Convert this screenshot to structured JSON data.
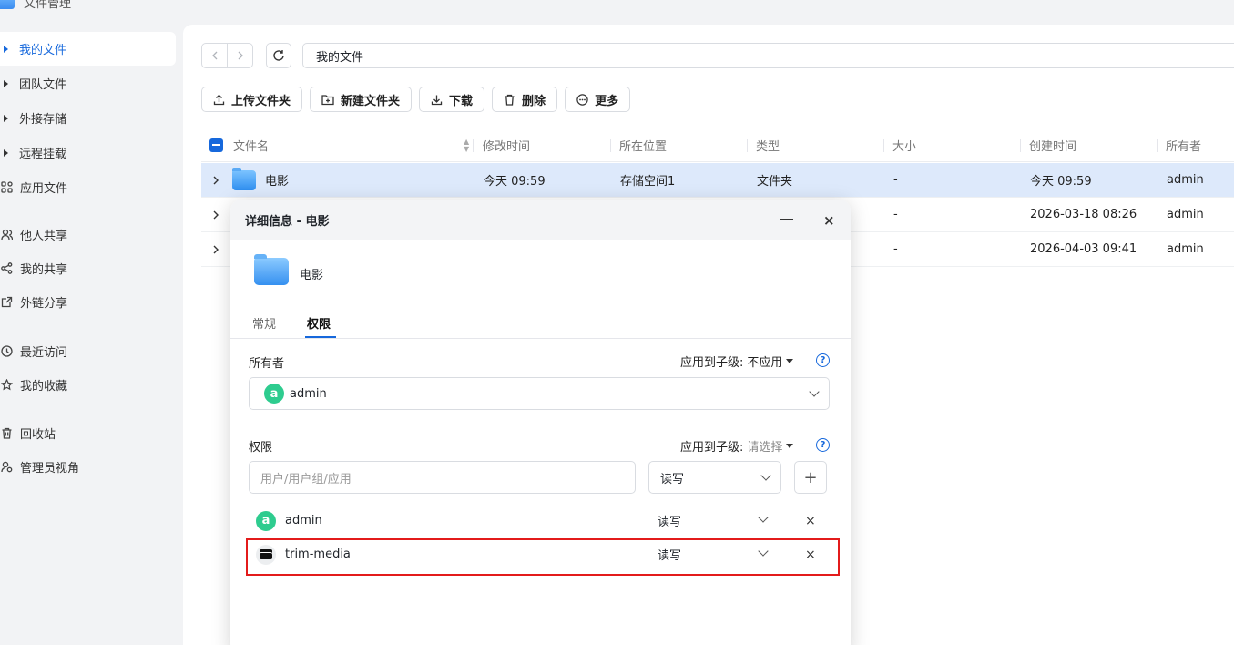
{
  "app": {
    "title": "文件管理"
  },
  "sidebar": {
    "items": [
      {
        "label": "我的文件",
        "icon": "caret-right-icon",
        "active": true
      },
      {
        "label": "团队文件",
        "icon": "caret-right-icon"
      },
      {
        "label": "外接存储",
        "icon": "caret-right-icon"
      },
      {
        "label": "远程挂载",
        "icon": "caret-right-icon"
      },
      {
        "label": "应用文件",
        "icon": "apps-grid-icon"
      },
      {
        "label": "他人共享",
        "icon": "users-icon"
      },
      {
        "label": "我的共享",
        "icon": "share-icon"
      },
      {
        "label": "外链分享",
        "icon": "external-share-icon"
      },
      {
        "label": "最近访问",
        "icon": "clock-icon"
      },
      {
        "label": "我的收藏",
        "icon": "star-icon"
      },
      {
        "label": "回收站",
        "icon": "trash-icon"
      },
      {
        "label": "管理员视角",
        "icon": "admin-view-icon"
      }
    ]
  },
  "path": {
    "current": "我的文件"
  },
  "toolbar": {
    "upload_folder": "上传文件夹",
    "new_folder": "新建文件夹",
    "download": "下载",
    "delete": "删除",
    "more": "更多"
  },
  "table": {
    "columns": [
      "文件名",
      "修改时间",
      "所在位置",
      "类型",
      "大小",
      "创建时间",
      "所有者"
    ],
    "rows": [
      {
        "name": "电影",
        "modified": "今天 09:59",
        "location": "存储空间1",
        "type": "文件夹",
        "size": "-",
        "created": "今天 09:59",
        "owner": "admin"
      },
      {
        "name": "",
        "modified": "",
        "location": "",
        "type": "",
        "size": "-",
        "created": "2026-03-18 08:26",
        "owner": "admin"
      },
      {
        "name": "",
        "modified": "",
        "location": "",
        "type": "",
        "size": "-",
        "created": "2026-04-03 09:41",
        "owner": "admin"
      }
    ]
  },
  "dialog": {
    "title": "详细信息 - 电影",
    "folder_name": "电影",
    "tabs": [
      "常规",
      "权限"
    ],
    "active_tab": "权限",
    "owner_label": "所有者",
    "apply_label": "应用到子级:",
    "owner_apply_value": "不应用",
    "owner_value": "admin",
    "owner_avatar": "a",
    "perm_label": "权限",
    "perm_apply_value": "请选择",
    "user_placeholder": "用户/用户组/应用",
    "perm_select_value": "读写",
    "add_symbol": "+",
    "entries": [
      {
        "avatar": "a",
        "name": "admin",
        "perm": "读写"
      },
      {
        "avatar": "",
        "name": "trim-media",
        "perm": "读写"
      }
    ],
    "help_symbol": "?",
    "close_symbol": "×"
  },
  "colors": {
    "accent": "#1668dc",
    "highlight": "#e31b1b",
    "avatar": "#2ecc8f"
  }
}
